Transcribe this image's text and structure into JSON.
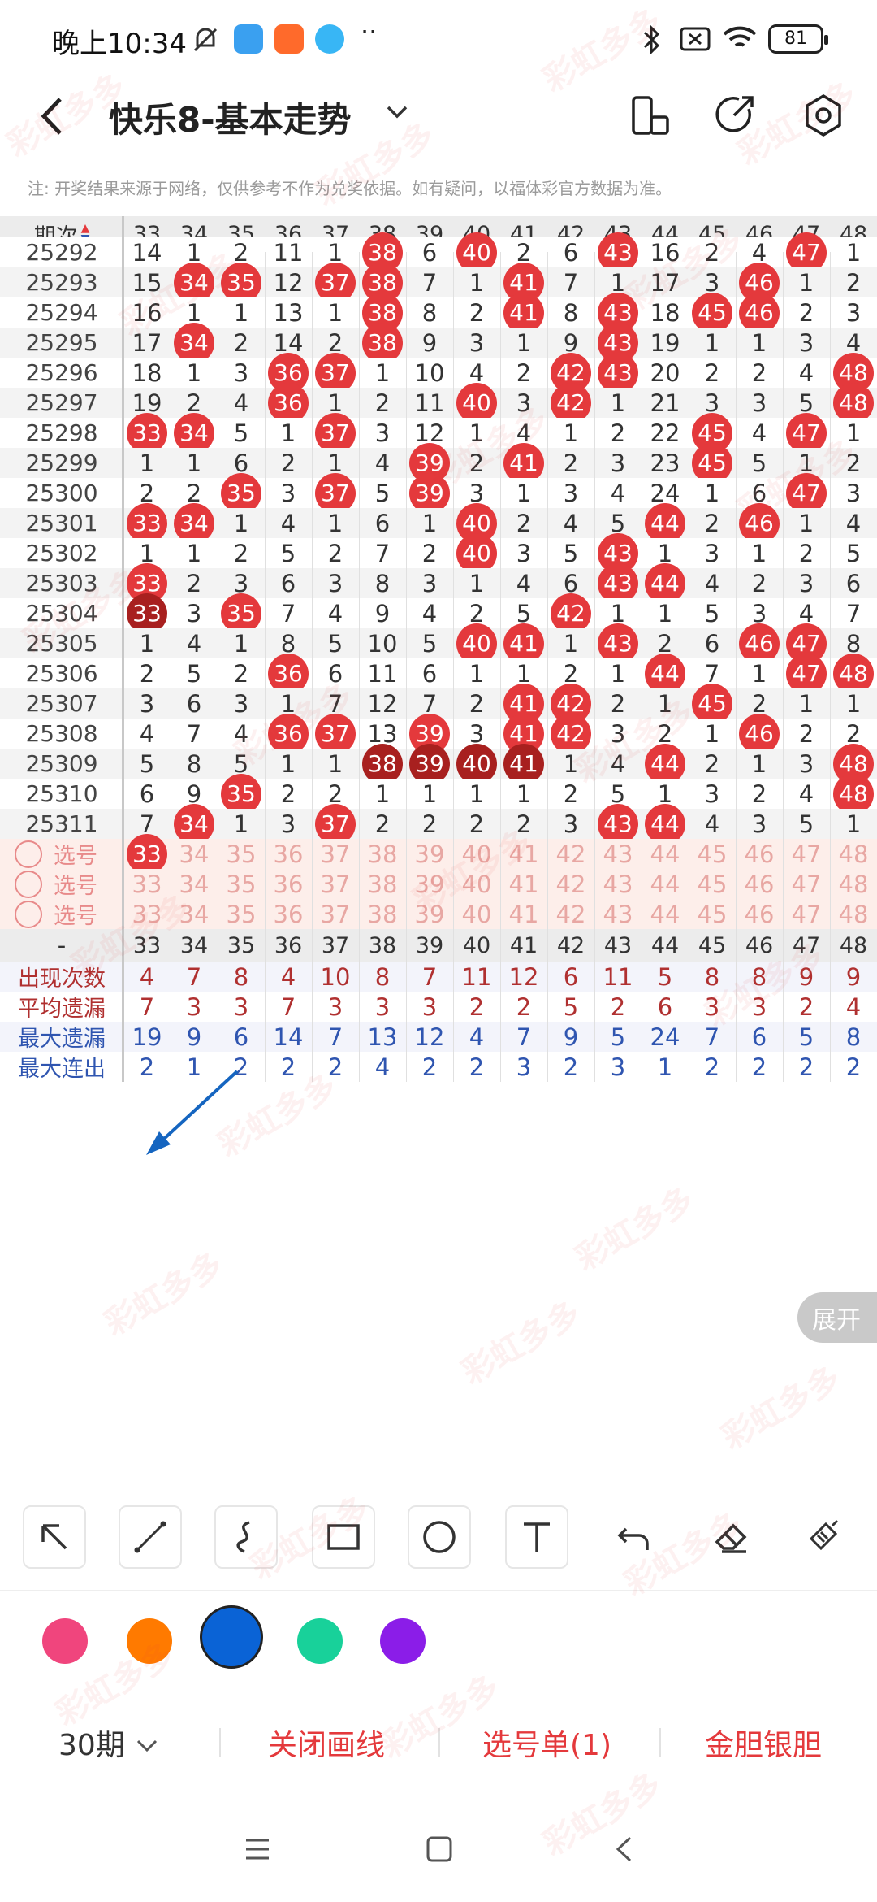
{
  "status_bar": {
    "time": "晚上10:34",
    "battery": "81"
  },
  "header": {
    "title": "快乐8-基本走势"
  },
  "note": "注: 开奖结果来源于网络，仅供参考不作为兑奖依据。如有疑问，以福体彩官方数据为准。",
  "grid": {
    "period_header": "期次",
    "columns": [
      "33",
      "34",
      "35",
      "36",
      "37",
      "38",
      "39",
      "40",
      "41",
      "42",
      "43",
      "44",
      "45",
      "46",
      "47",
      "48"
    ],
    "rows": [
      {
        "period": "25292",
        "cells": [
          "14",
          "1",
          "2",
          "11",
          "1",
          "38",
          "6",
          "40",
          "2",
          "6",
          "43",
          "16",
          "2",
          "4",
          "47",
          "1"
        ]
      },
      {
        "period": "25293",
        "cells": [
          "15",
          "34",
          "35",
          "12",
          "37",
          "38",
          "7",
          "1",
          "41",
          "7",
          "1",
          "17",
          "3",
          "46",
          "1",
          "2"
        ]
      },
      {
        "period": "25294",
        "cells": [
          "16",
          "1",
          "1",
          "13",
          "1",
          "38",
          "8",
          "2",
          "41",
          "8",
          "43",
          "18",
          "45",
          "46",
          "2",
          "3"
        ]
      },
      {
        "period": "25295",
        "cells": [
          "17",
          "34",
          "2",
          "14",
          "2",
          "38",
          "9",
          "3",
          "1",
          "9",
          "43",
          "19",
          "1",
          "1",
          "3",
          "4"
        ]
      },
      {
        "period": "25296",
        "cells": [
          "18",
          "1",
          "3",
          "36",
          "37",
          "1",
          "10",
          "4",
          "2",
          "42",
          "43",
          "20",
          "2",
          "2",
          "4",
          "48"
        ]
      },
      {
        "period": "25297",
        "cells": [
          "19",
          "2",
          "4",
          "36",
          "1",
          "2",
          "11",
          "40",
          "3",
          "42",
          "1",
          "21",
          "3",
          "3",
          "5",
          "48"
        ]
      },
      {
        "period": "25298",
        "cells": [
          "33",
          "34",
          "5",
          "1",
          "37",
          "3",
          "12",
          "1",
          "4",
          "1",
          "2",
          "22",
          "45",
          "4",
          "47",
          "1"
        ]
      },
      {
        "period": "25299",
        "cells": [
          "1",
          "1",
          "6",
          "2",
          "1",
          "4",
          "39",
          "2",
          "41",
          "2",
          "3",
          "23",
          "45",
          "5",
          "1",
          "2"
        ]
      },
      {
        "period": "25300",
        "cells": [
          "2",
          "2",
          "35",
          "3",
          "37",
          "5",
          "39",
          "3",
          "1",
          "3",
          "4",
          "24",
          "1",
          "6",
          "47",
          "3"
        ]
      },
      {
        "period": "25301",
        "cells": [
          "33",
          "34",
          "1",
          "4",
          "1",
          "6",
          "1",
          "40",
          "2",
          "4",
          "5",
          "44",
          "2",
          "46",
          "1",
          "4"
        ]
      },
      {
        "period": "25302",
        "cells": [
          "1",
          "1",
          "2",
          "5",
          "2",
          "7",
          "2",
          "40",
          "3",
          "5",
          "43",
          "1",
          "3",
          "1",
          "2",
          "5"
        ]
      },
      {
        "period": "25303",
        "cells": [
          "33",
          "2",
          "3",
          "6",
          "3",
          "8",
          "3",
          "1",
          "4",
          "6",
          "43",
          "44",
          "4",
          "2",
          "3",
          "6"
        ]
      },
      {
        "period": "25304",
        "cells": [
          "33",
          "3",
          "35",
          "7",
          "4",
          "9",
          "4",
          "2",
          "5",
          "42",
          "1",
          "1",
          "5",
          "3",
          "4",
          "7"
        ]
      },
      {
        "period": "25305",
        "cells": [
          "1",
          "4",
          "1",
          "8",
          "5",
          "10",
          "5",
          "40",
          "41",
          "1",
          "43",
          "2",
          "6",
          "46",
          "47",
          "8"
        ]
      },
      {
        "period": "25306",
        "cells": [
          "2",
          "5",
          "2",
          "36",
          "6",
          "11",
          "6",
          "1",
          "1",
          "2",
          "1",
          "44",
          "7",
          "1",
          "47",
          "48"
        ]
      },
      {
        "period": "25307",
        "cells": [
          "3",
          "6",
          "3",
          "1",
          "7",
          "12",
          "7",
          "2",
          "41",
          "42",
          "2",
          "1",
          "45",
          "2",
          "1",
          "1"
        ]
      },
      {
        "period": "25308",
        "cells": [
          "4",
          "7",
          "4",
          "36",
          "37",
          "13",
          "39",
          "3",
          "41",
          "42",
          "3",
          "2",
          "1",
          "46",
          "2",
          "2"
        ]
      },
      {
        "period": "25309",
        "cells": [
          "5",
          "8",
          "5",
          "1",
          "1",
          "38",
          "39",
          "40",
          "41",
          "1",
          "4",
          "44",
          "2",
          "1",
          "3",
          "48"
        ]
      },
      {
        "period": "25310",
        "cells": [
          "6",
          "9",
          "35",
          "2",
          "2",
          "1",
          "1",
          "1",
          "1",
          "2",
          "5",
          "1",
          "3",
          "2",
          "4",
          "48"
        ]
      },
      {
        "period": "25311",
        "cells": [
          "7",
          "34",
          "1",
          "3",
          "37",
          "2",
          "2",
          "2",
          "2",
          "3",
          "43",
          "44",
          "4",
          "3",
          "5",
          "1"
        ]
      }
    ],
    "select_label": "选号",
    "select_rows": [
      {
        "cells": [
          "33",
          "34",
          "35",
          "36",
          "37",
          "38",
          "39",
          "40",
          "41",
          "42",
          "43",
          "44",
          "45",
          "46",
          "47",
          "48"
        ],
        "selected": [
          "33"
        ]
      },
      {
        "cells": [
          "33",
          "34",
          "35",
          "36",
          "37",
          "38",
          "39",
          "40",
          "41",
          "42",
          "43",
          "44",
          "45",
          "46",
          "47",
          "48"
        ],
        "selected": []
      },
      {
        "cells": [
          "33",
          "34",
          "35",
          "36",
          "37",
          "38",
          "39",
          "40",
          "41",
          "42",
          "43",
          "44",
          "45",
          "46",
          "47",
          "48"
        ],
        "selected": []
      }
    ],
    "dash_label": "-",
    "stats": [
      {
        "label": "出现次数",
        "values": [
          "4",
          "7",
          "8",
          "4",
          "10",
          "8",
          "7",
          "11",
          "12",
          "6",
          "11",
          "5",
          "8",
          "8",
          "9",
          "9"
        ],
        "color": "#b03030"
      },
      {
        "label": "平均遗漏",
        "values": [
          "7",
          "3",
          "3",
          "7",
          "3",
          "3",
          "3",
          "2",
          "2",
          "5",
          "2",
          "6",
          "3",
          "3",
          "2",
          "4"
        ],
        "color": "#b03030"
      },
      {
        "label": "最大遗漏",
        "values": [
          "19",
          "9",
          "6",
          "14",
          "7",
          "13",
          "12",
          "4",
          "7",
          "9",
          "5",
          "24",
          "7",
          "6",
          "5",
          "8"
        ],
        "color": "#2f55b0"
      },
      {
        "label": "最大连出",
        "values": [
          "2",
          "1",
          "2",
          "2",
          "2",
          "4",
          "2",
          "2",
          "3",
          "2",
          "3",
          "1",
          "2",
          "2",
          "2",
          "2"
        ],
        "color": "#2f55b0"
      }
    ],
    "dark_balls": [
      [
        "25304",
        "33"
      ],
      [
        "25309",
        "38"
      ],
      [
        "25309",
        "39"
      ],
      [
        "25309",
        "40"
      ],
      [
        "25309",
        "41"
      ]
    ]
  },
  "expand_label": "展开",
  "tools": [
    "arrow-tool-icon",
    "line-tool-icon",
    "curve-tool-icon",
    "rectangle-tool-icon",
    "circle-tool-icon",
    "text-tool-icon",
    "undo-icon",
    "eraser-icon",
    "clear-icon"
  ],
  "palette": [
    {
      "name": "pink",
      "color": "#f0457d"
    },
    {
      "name": "orange",
      "color": "#ff7a00"
    },
    {
      "name": "blue",
      "color": "#0a63d6",
      "selected": true
    },
    {
      "name": "green",
      "color": "#18d19a"
    },
    {
      "name": "purple",
      "color": "#8b1de8"
    }
  ],
  "bottom": {
    "period_select": "30期",
    "close_draw": "关闭画线",
    "pick_list": "选号单(1)",
    "gold_silver": "金胆银胆"
  },
  "watermark": "彩虹多多"
}
